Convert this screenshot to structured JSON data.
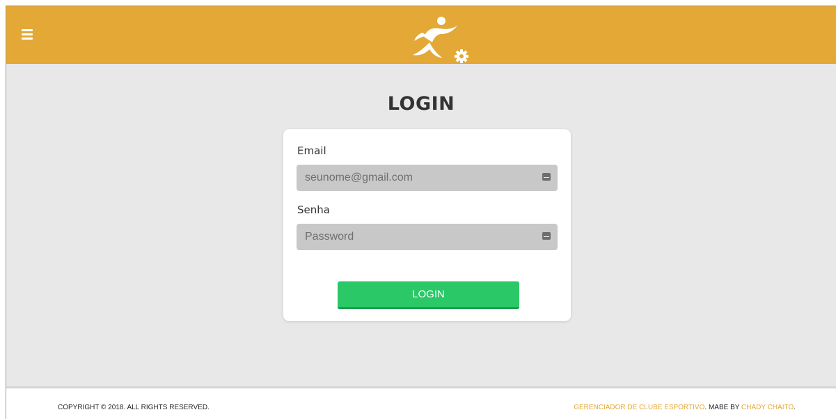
{
  "colors": {
    "header": "#e3a835",
    "accent": "#e3a835",
    "background": "#e8e8e8",
    "login_button": "#2ac866",
    "input_background": "#c8c8c8"
  },
  "header": {
    "menu_icon": "hamburger-menu-icon",
    "logo_icon": "runner-gear-logo-icon"
  },
  "login": {
    "title": "LOGIN",
    "email_label": "Email",
    "email_placeholder": "seunome@gmail.com",
    "password_label": "Senha",
    "password_placeholder": "Password",
    "field_icon": "keypad-icon",
    "button_label": "LOGIN"
  },
  "footer": {
    "copyright": "COPYRIGHT © 2018. ALL RIGHTS RESERVED.",
    "app_name": "GERENCIADOR DE CLUBE ESPORTIVO",
    "made_by": ". MABE BY ",
    "author": "CHADY CHAITO",
    "period": "."
  }
}
